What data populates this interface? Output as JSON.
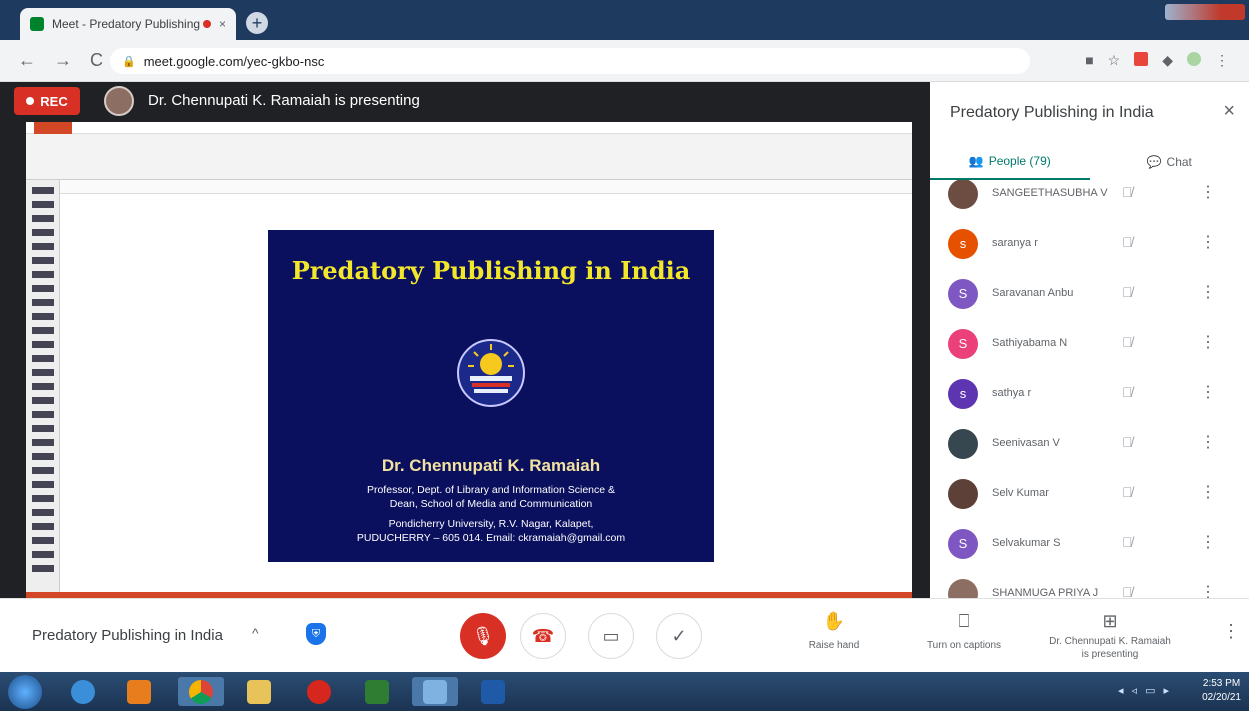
{
  "browser": {
    "tab_title": "Meet - Predatory Publishing",
    "tab_close": "×",
    "new_tab": "+",
    "url": "meet.google.com/yec-gkbo-nsc",
    "nav_back": "←",
    "nav_forward": "→",
    "nav_reload": "C"
  },
  "meeting": {
    "rec_label": "REC",
    "presenting_text": "Dr. Chennupati K. Ramaiah is presenting",
    "title": "Predatory Publishing in India",
    "caret": "^"
  },
  "slide": {
    "title": "Predatory Publishing in India",
    "author": "Dr. Chennupati K. Ramaiah",
    "lines": [
      "Professor, Dept. of Library and Information Science &",
      "Dean, School of Media and Communication",
      "Pondicherry University, R.V. Nagar, Kalapet,",
      "PUDUCHERRY – 605 014. Email: ckramaiah@gmail.com"
    ]
  },
  "panel": {
    "title": "Predatory Publishing in India",
    "close": "×",
    "tab_people": "People (79)",
    "tab_chat": "Chat",
    "people": [
      {
        "name": "SANGEETHASUBHA V",
        "initial": "",
        "color": "#6d4c41"
      },
      {
        "name": "saranya r",
        "initial": "s",
        "color": "#e65100"
      },
      {
        "name": "Saravanan Anbu",
        "initial": "S",
        "color": "#7e57c2"
      },
      {
        "name": "Sathiyabama N",
        "initial": "S",
        "color": "#ec407a"
      },
      {
        "name": "sathya r",
        "initial": "s",
        "color": "#5e35b1"
      },
      {
        "name": "Seenivasan V",
        "initial": "",
        "color": "#37474f"
      },
      {
        "name": "Selv Kumar",
        "initial": "",
        "color": "#5d4037"
      },
      {
        "name": "Selvakumar S",
        "initial": "S",
        "color": "#7e57c2"
      },
      {
        "name": "SHANMUGA PRIYA J",
        "initial": "",
        "color": "#8d6e63"
      }
    ]
  },
  "controls": {
    "raise_hand": "Raise hand",
    "captions": "Turn on captions",
    "presenting_line1": "Dr. Chennupati K. Ramaiah",
    "presenting_line2": "is presenting"
  },
  "taskbar": {
    "time": "2:53 PM",
    "date": "02/20/21"
  }
}
